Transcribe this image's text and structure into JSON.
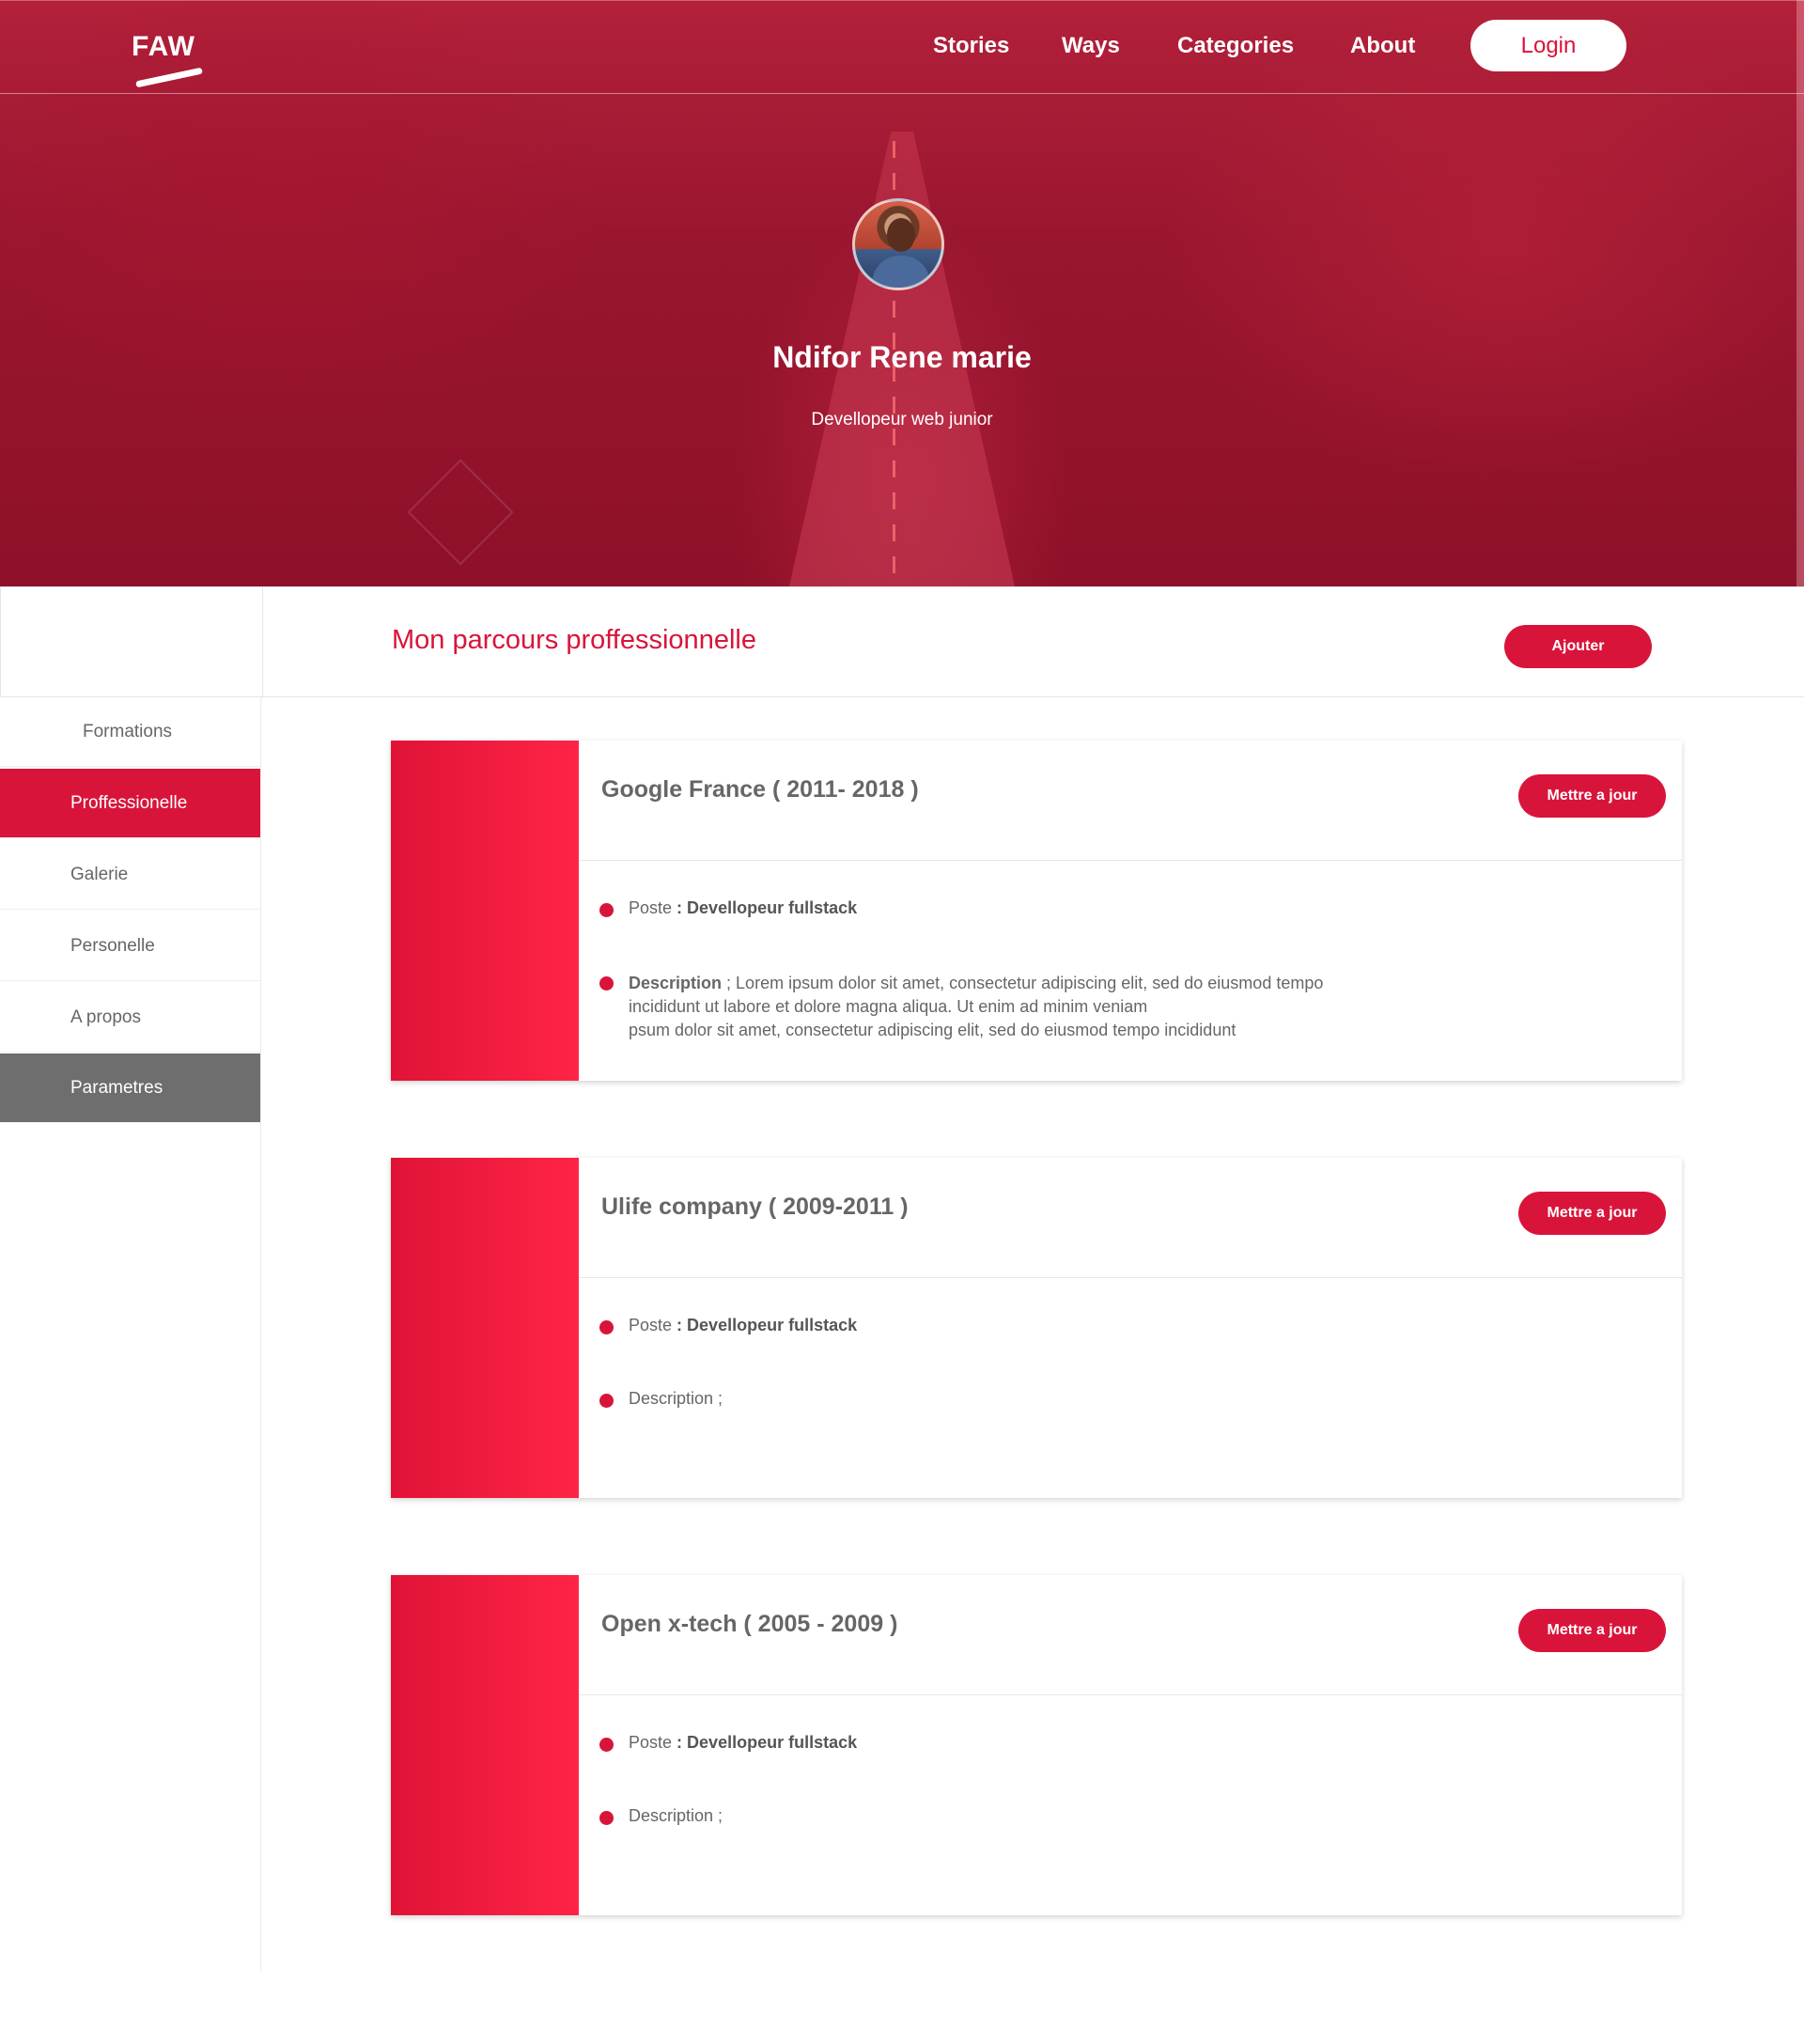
{
  "nav": {
    "logo": "FAW",
    "items": [
      "Stories",
      "Ways",
      "Categories",
      "About"
    ],
    "login": "Login"
  },
  "profile": {
    "name": "Ndifor Rene marie",
    "role": "Devellopeur web junior"
  },
  "section": {
    "title": "Mon parcours proffessionnelle",
    "add_button": "Ajouter"
  },
  "sidebar": {
    "items": [
      {
        "label": "Formations"
      },
      {
        "label": "Proffessionelle",
        "active": true
      },
      {
        "label": "Galerie"
      },
      {
        "label": "Personelle"
      },
      {
        "label": "A propos"
      },
      {
        "label": "Parametres"
      }
    ]
  },
  "experiences": [
    {
      "title": "Google France ( 2011- 2018 )",
      "update_button": "Mettre a jour",
      "poste_label": "Poste",
      "poste_value": ": Devellopeur fullstack",
      "description_label": "Description",
      "description_sep": " ; ",
      "description_lines": [
        "Lorem ipsum dolor sit amet, consectetur adipiscing elit, sed do eiusmod tempo",
        "incididunt ut labore et dolore magna aliqua. Ut enim ad minim veniam",
        "psum dolor sit amet, consectetur adipiscing elit, sed do eiusmod tempo incididunt"
      ]
    },
    {
      "title": "Ulife company ( 2009-2011 )",
      "update_button": "Mettre a jour",
      "poste_label": "Poste",
      "poste_value": ": Devellopeur fullstack",
      "description_label": "Description ;"
    },
    {
      "title": "Open x-tech ( 2005 - 2009 )",
      "update_button": "Mettre a jour",
      "poste_label": "Poste",
      "poste_value": ": Devellopeur fullstack",
      "description_label": "Description ;"
    }
  ],
  "colors": {
    "accent": "#d9143a",
    "settings_bg": "#6e6e6e",
    "hero": "#9a1630"
  }
}
